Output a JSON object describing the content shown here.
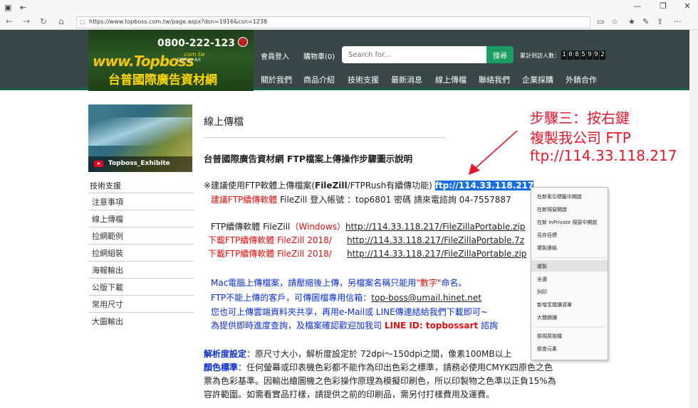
{
  "browser": {
    "url": "https://www.topboss.com.tw/page.aspx?dsn=1916&csn=1238",
    "window_controls": [
      "—",
      "❐",
      "✕"
    ]
  },
  "site": {
    "logo": {
      "phone": "0800-222-123",
      "wordmark": "www.Topboss",
      "domain": ".com.tw",
      "tagline": "DisPlay Art",
      "name": "台普國際廣告資材網"
    },
    "header_links": {
      "member": "會員登入",
      "cart": "購物車(0)"
    },
    "search": {
      "placeholder": "Search for...",
      "button": "搜尋"
    },
    "visitors": {
      "label": "累計到訪人數：",
      "count": [
        "1",
        "0",
        "8",
        "5",
        "9",
        "9",
        "2"
      ]
    },
    "nav": [
      "關於我們",
      "商品介紹",
      "技術支援",
      "最新消息",
      "線上傳檔",
      "聯絡我們",
      "企業採購",
      "外銷合作"
    ]
  },
  "sidebar": {
    "banner_caption": "Topboss_Exhibite",
    "title": "技術支援",
    "items": [
      "注意事項",
      "線上傳檔",
      "拉網範例",
      "拉網組裝",
      "海報輸出",
      "公版下載",
      "常用尺寸",
      "大圖輸出"
    ]
  },
  "content": {
    "heading": "線上傳檔",
    "subheading": "台普國際廣告資材網 FTP檔案上傳操作步驟圖示說明",
    "suggest_prefix": "※建議使用FTP軟體上傳檔案(",
    "suggest_bold": "FileZill",
    "suggest_suffix": "/FTPRush有續傳功能)",
    "ftp_selected": "ftp://114.33.118.217",
    "recommend_red": "建議FTP續傳軟體",
    "recommend_text": " FileZill 登入帳號 ：top6801 密碼 請來電諮詢 04-7557887",
    "dl1_prefix": "FTP續傳軟體 FileZill",
    "dl1_red": "（Windows）",
    "dl1_link": "http://114.33.118.217/FileZillaPortable.zip",
    "dl2_label": "下載FTP續傳軟體 FileZill 2018/",
    "dl2_link": "http://114.33.118.217/FileZillaPortable.7z",
    "dl3_label": "下載FTP續傳軟體 FileZill 2018/",
    "dl3_link": "http://114.33.118.217/FileZillaPortable.zip",
    "mac_a": "Mac電腦上傳檔案，請壓縮後上傳，另檔案名稱只能用",
    "mac_red": "\"數字\"",
    "mac_b": "命名。",
    "mail_a": "FTP不能上傳的客戶，可傳圖檔專用信箱：",
    "mail_link": "top-boss@umail.hinet.net",
    "cloud": "您也可上傳雲端資料夾共享，再用e-Mail或 LINE傳連結給我們下載即可~",
    "line_a": "為提供即時進度查詢，及檔案確認歡迎加我司 ",
    "line_red": "LINE ID: topbossart",
    "line_b": " 諮詢",
    "res_label": "解析度設定",
    "res_text": "：原尺寸大小，解析度設定於 72dpi～150dpi之間，像素100MB以上",
    "color_label": "顏色標準",
    "color_text": "：任何螢幕或印表機色彩都不能作為印出色彩之標準，請務必使用CMYK四原色之色",
    "color_text2": "票為色彩基準。因輸出繪圖機之色彩操作原理為模擬印刷色，所以印製物之色準以正負15%為",
    "color_text3": "容許範圍。如需看實品打樣，請提供之前的印刷品，需另付打樣費用及運費。"
  },
  "annotation": {
    "line1": "步驟三：按右鍵",
    "line2": "複製我公司  FTP",
    "line3": "ftp://114.33.118.217"
  },
  "context_menu": {
    "items": [
      "在新索引標籤中開啟",
      "在新視窗開啟",
      "在新 InPrivate 視窗中開啟",
      "另存目標",
      "複製連結",
      "複製",
      "全選",
      "列印",
      "新增至閱讀清單",
      "大聲朗讀",
      "檢視原始檔",
      "檢查元素"
    ],
    "selected": "複製"
  },
  "colors": {
    "header": "#3a4749",
    "accent_green": "#1a9e62",
    "annotation_red": "#e4182c",
    "selection_blue": "#1a6fdc"
  }
}
